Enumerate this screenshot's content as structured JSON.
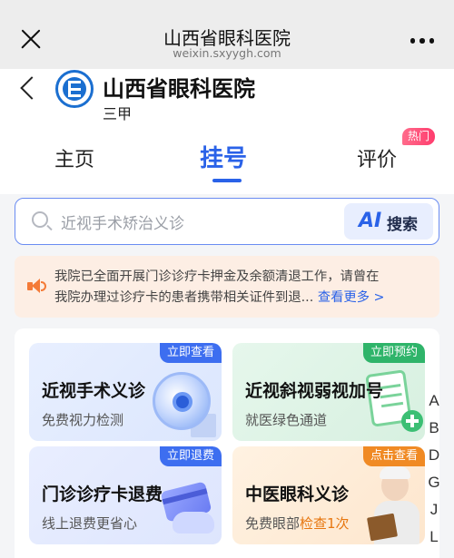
{
  "wechat": {
    "title": "山西省眼科医院",
    "url": "weixin.sxyygh.com"
  },
  "hospital": {
    "name": "山西省眼科医院",
    "level": "三甲"
  },
  "tabs": [
    {
      "label": "主页",
      "active": false
    },
    {
      "label": "挂号",
      "active": true
    },
    {
      "label": "评价",
      "active": false,
      "badge": "热门"
    }
  ],
  "search": {
    "placeholder": "近视手术矫治义诊",
    "button_label": "搜索",
    "button_icon": "AI"
  },
  "notice": {
    "line1": "我院已全面开展门诊诊疗卡押金及余额清退工作，请曾在",
    "line2": "我院办理过诊疗卡的患者携带相关证件到退...",
    "more_label": "查看更多 >"
  },
  "cards": [
    {
      "title": "近视手术义诊",
      "subtitle": "免费视力检测",
      "tag": "立即查看",
      "icon": "eye-icon"
    },
    {
      "title": "近视斜视弱视加号",
      "subtitle": "就医绿色通道",
      "tag": "立即预约",
      "icon": "clipboard-plus-icon"
    },
    {
      "title": "门诊诊疗卡退费",
      "subtitle": "线上退费更省心",
      "tag": "立即退费",
      "icon": "credit-card-icon"
    },
    {
      "title": "中医眼科义诊",
      "subtitle_prefix": "免费眼部",
      "subtitle_highlight": "检查1次",
      "tag": "点击查看",
      "icon": "doctor-icon"
    }
  ],
  "alpha_index": [
    "A",
    "B",
    "D",
    "G",
    "J",
    "L"
  ],
  "colors": {
    "accent": "#2a62e8",
    "notice_bg": "#fdeee4",
    "notice_icon": "#f47a37",
    "hot_badge": "#ff3d6e"
  }
}
